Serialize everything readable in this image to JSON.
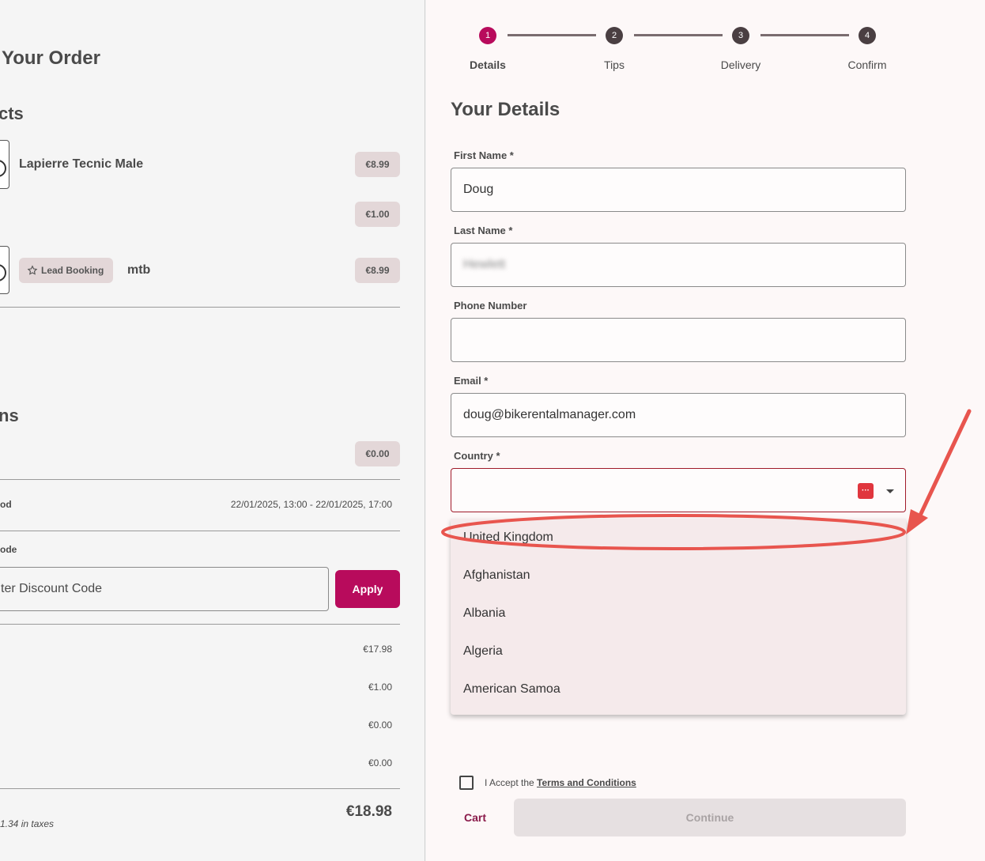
{
  "order": {
    "title": "Your Order",
    "products_heading": "cts",
    "products": [
      {
        "name": "Lapierre Tecnic Male",
        "price": "€8.99"
      },
      {
        "name": "",
        "price": "€1.00"
      },
      {
        "badge": "Lead Booking",
        "name": "mtb",
        "price": "€8.99"
      }
    ],
    "addons_heading": "ns",
    "addons_price": "€0.00",
    "period_label": "od",
    "period_value": "22/01/2025, 13:00 - 22/01/2025, 17:00",
    "discount_label": "ode",
    "discount_placeholder": "ter Discount Code",
    "apply_label": "Apply",
    "summary": [
      "€17.98",
      "€1.00",
      "€0.00",
      "€0.00"
    ],
    "total": "€18.98",
    "tax_note": "1.34 in taxes"
  },
  "stepper": {
    "steps": [
      {
        "num": "1",
        "label": "Details"
      },
      {
        "num": "2",
        "label": "Tips"
      },
      {
        "num": "3",
        "label": "Delivery"
      },
      {
        "num": "4",
        "label": "Confirm"
      }
    ]
  },
  "details": {
    "title": "Your Details",
    "first_name_label": "First Name *",
    "first_name_value": "Doug",
    "last_name_label": "Last Name *",
    "last_name_value": "Hewlett",
    "phone_label": "Phone Number",
    "phone_value": "",
    "email_label": "Email *",
    "email_value": "doug@bikerentalmanager.com",
    "country_label": "Country *",
    "country_value": "",
    "country_options": [
      "United Kingdom",
      "Afghanistan",
      "Albania",
      "Algeria",
      "American Samoa"
    ]
  },
  "footer": {
    "accept_prefix": "I Accept the ",
    "terms_link": "Terms and Conditions",
    "cart_label": "Cart",
    "continue_label": "Continue"
  },
  "colors": {
    "accent": "#b80b5c",
    "annotation": "#e8554e"
  }
}
